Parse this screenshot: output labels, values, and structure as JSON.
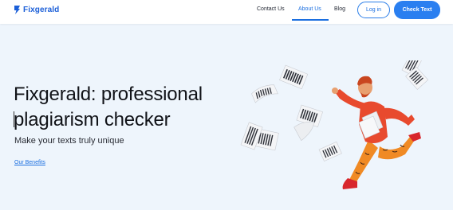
{
  "header": {
    "brand_name": "Fixgerald",
    "nav": [
      {
        "label": "Contact Us",
        "active": false
      },
      {
        "label": "About Us",
        "active": true
      },
      {
        "label": "Blog",
        "active": false
      }
    ],
    "login_label": "Log in",
    "cta_label": "Check Text"
  },
  "hero": {
    "title": "Fixgerald: professional plagiarism checker",
    "subtitle": "Make your texts truly unique",
    "link_label": "Our Benefits"
  },
  "colors": {
    "brand_blue": "#1b5fd8",
    "accent_blue": "#2a7ff0",
    "hero_bg": "#eef5fc",
    "character_red": "#e84a2e",
    "character_orange": "#f08a24"
  },
  "icons": {
    "logo": "fixgerald-logo-icon",
    "illustration": "running-man-with-papers-illustration"
  }
}
